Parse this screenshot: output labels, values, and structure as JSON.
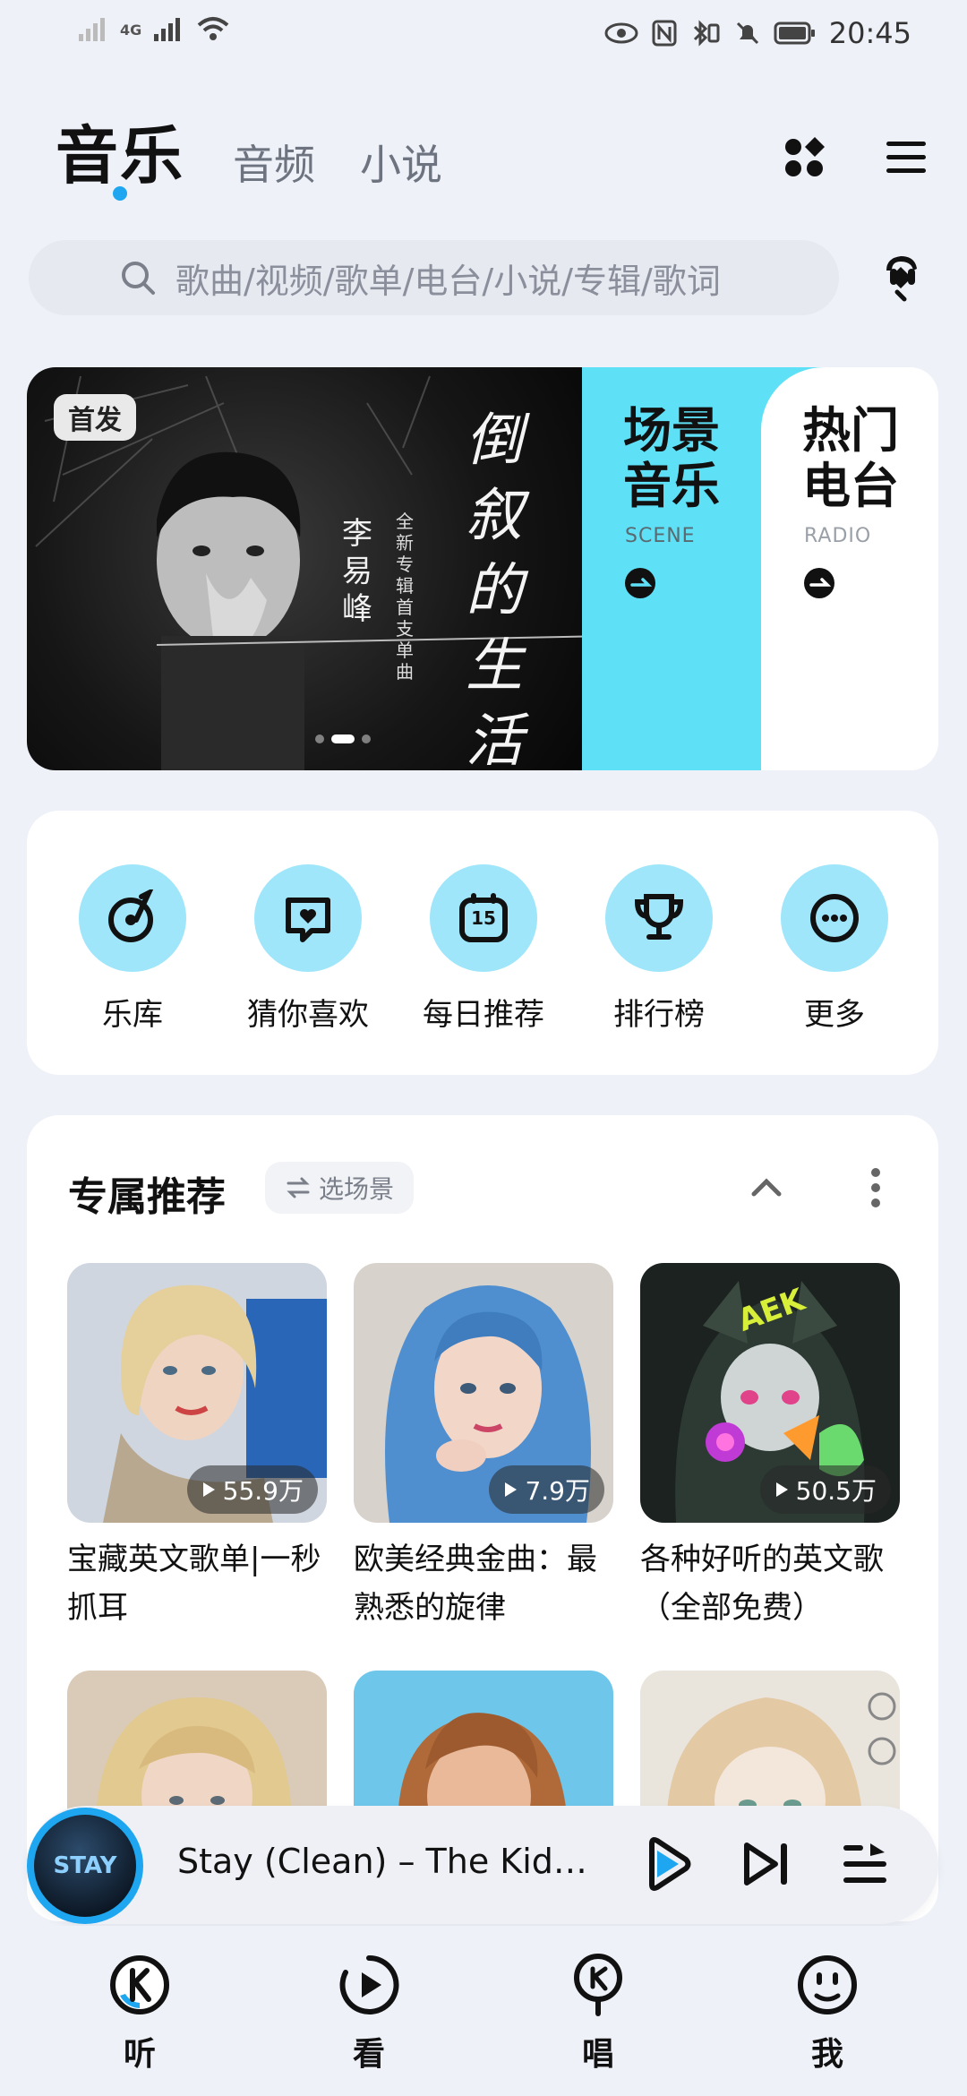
{
  "status_bar": {
    "network": "4G",
    "time": "20:45"
  },
  "tabs": {
    "active": "音乐",
    "items": [
      "音频",
      "小说"
    ]
  },
  "search": {
    "placeholder": "歌曲/视频/歌单/电台/小说/专辑/歌词"
  },
  "banner": {
    "badge": "首发",
    "artist": "李易峰",
    "tagline": "全新专辑首支单曲",
    "handwritten_title": "倒叙的生活",
    "pages": 3,
    "active_page": 2,
    "cards": [
      {
        "title_line1": "场景",
        "title_line2": "音乐",
        "subtitle": "SCENE"
      },
      {
        "title_line1": "热门",
        "title_line2": "电台",
        "subtitle": "RADIO"
      }
    ]
  },
  "quick_nav": [
    {
      "label": "乐库",
      "icon": "record-icon"
    },
    {
      "label": "猜你喜欢",
      "icon": "heart-bubble-icon"
    },
    {
      "label": "每日推荐",
      "icon": "calendar-icon",
      "icon_text": "15"
    },
    {
      "label": "排行榜",
      "icon": "trophy-icon"
    },
    {
      "label": "更多",
      "icon": "more-dots-icon"
    }
  ],
  "recommend": {
    "title": "专属推荐",
    "scene_button": "选场景",
    "playlists": [
      {
        "title": "宝藏英文歌单|一秒抓耳",
        "plays": "55.9万"
      },
      {
        "title": "欧美经典金曲：最熟悉的旋律",
        "plays": "7.9万"
      },
      {
        "title": "各种好听的英文歌（全部免费）",
        "plays": "50.5万"
      }
    ]
  },
  "player": {
    "now_playing": "Stay (Clean)  –  The Kid…",
    "art_text": "STAY"
  },
  "bottom_nav": [
    {
      "label": "听",
      "icon": "listen-icon"
    },
    {
      "label": "看",
      "icon": "watch-icon"
    },
    {
      "label": "唱",
      "icon": "sing-icon"
    },
    {
      "label": "我",
      "icon": "me-icon"
    }
  ],
  "colors": {
    "accent": "#1ea7f0",
    "icon_bg": "#9fe6fb",
    "scene_card": "#5ee0f6",
    "page_bg": "#eef1f8"
  }
}
